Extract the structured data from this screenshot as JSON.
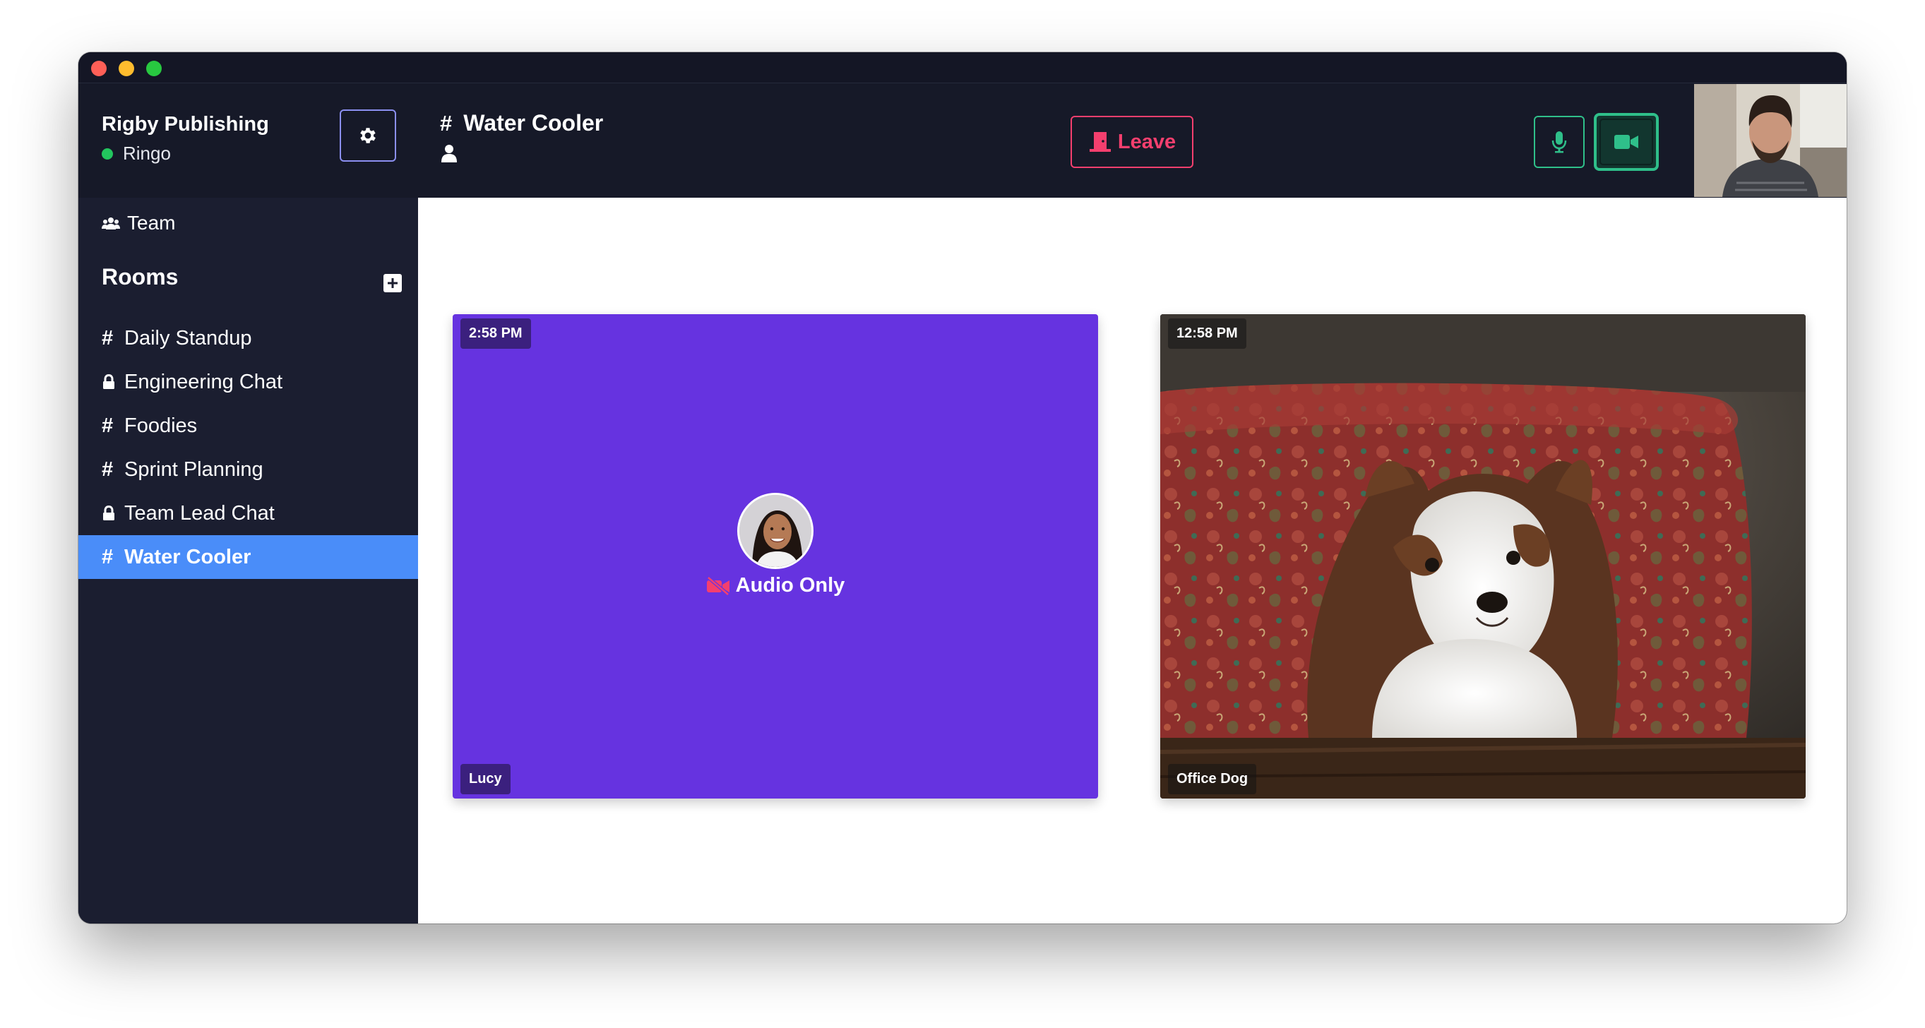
{
  "workspace": {
    "name": "Rigby Publishing",
    "user": "Ringo",
    "user_status": "online"
  },
  "room": {
    "hash": "#",
    "title": "Water Cooler"
  },
  "controls": {
    "leave_label": "Leave",
    "mic": "on",
    "camera": "on"
  },
  "sidebar": {
    "team_label": "Team",
    "rooms_heading": "Rooms",
    "rooms": [
      {
        "name": "Daily Standup",
        "type": "public",
        "prefix": "#"
      },
      {
        "name": "Engineering Chat",
        "type": "private"
      },
      {
        "name": "Foodies",
        "type": "public",
        "prefix": "#"
      },
      {
        "name": "Sprint Planning",
        "type": "public",
        "prefix": "#"
      },
      {
        "name": "Team Lead Chat",
        "type": "private"
      },
      {
        "name": "Water Cooler",
        "type": "public",
        "prefix": "#",
        "active": true
      }
    ]
  },
  "tiles": [
    {
      "time": "2:58 PM",
      "name": "Lucy",
      "status": "Audio Only"
    },
    {
      "time": "12:58 PM",
      "name": "Office Dog"
    }
  ],
  "colors": {
    "accent": "#4a8df9",
    "leave": "#f43f6e",
    "media_on": "#2fbf8a",
    "online": "#22c55e",
    "lucy_tile": "#6633e0"
  }
}
